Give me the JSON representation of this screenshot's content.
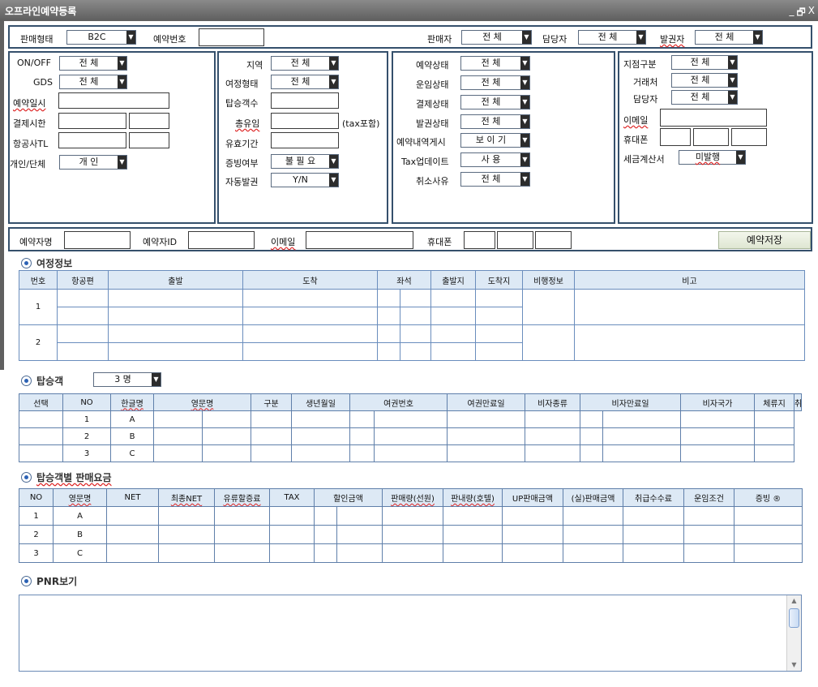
{
  "window": {
    "title": "오프라인예약등록",
    "min": "_",
    "restore": "🗗",
    "close": "X"
  },
  "top": {
    "sale_type_label": "판매형태",
    "sale_type": "B2C",
    "resv_no_label": "예약번호",
    "resv_no": "",
    "seller_label": "판매자",
    "seller": "전 체",
    "manager_label": "담당자",
    "manager": "전 체",
    "issuer_label": "발권자",
    "issuer": "전 체"
  },
  "filter1": {
    "onoff_label": "ON/OFF",
    "onoff": "전 체",
    "gds_label": "GDS",
    "gds": "전 체",
    "resv_date_label": "예약일시",
    "pay_deadline_label": "결제시한",
    "airline_tl_label": "항공사TL",
    "pax_type_label": "개인/단체",
    "pax_type": "개 인"
  },
  "filter2": {
    "region_label": "지역",
    "region": "전 체",
    "trip_type_label": "여정형태",
    "trip_type": "전 체",
    "pax_count_label": "탑승객수",
    "fuel_label": "총유임",
    "tax_note": "(tax포함)",
    "valid_label": "유효기간",
    "proof_label": "증빙여부",
    "proof": "불 필 요",
    "auto_issue_label": "자동발권",
    "auto_issue": "Y/N"
  },
  "filter3": {
    "resv_status_label": "예약상태",
    "resv_status": "전 체",
    "fare_status_label": "운임상태",
    "fare_status": "전 체",
    "pay_status_label": "결제상태",
    "pay_status": "전 체",
    "issue_status_label": "발권상태",
    "issue_status": "전 체",
    "resv_post_label": "예약내역게시",
    "resv_post": "보 이 기",
    "tax_update_label": "Tax업데이트",
    "tax_update": "사  용",
    "cancel_reason_label": "취소사유",
    "cancel_reason": "전 체"
  },
  "filter4": {
    "branch_label": "지점구분",
    "branch": "전 체",
    "client_label": "거래처",
    "client": "전 체",
    "manager_label": "담당자",
    "manager": "전 체",
    "email_label": "이메일",
    "phone_label": "휴대폰",
    "invoice_label": "세금계산서",
    "invoice": "미발행"
  },
  "booker": {
    "name_label": "예약자명",
    "id_label": "예약자ID",
    "email_label": "이메일",
    "phone_label": "휴대폰",
    "save_label": "예약저장"
  },
  "itinerary": {
    "section_title": "여정정보",
    "headers": [
      "번호",
      "항공편",
      "출발",
      "도착",
      "좌석",
      "출발지",
      "도착지",
      "비행정보",
      "비고"
    ],
    "rows": [
      "1",
      "2"
    ]
  },
  "passengers": {
    "section_title": "탑승객",
    "count": "3 명",
    "headers": [
      "선택",
      "NO",
      "한글명",
      "영문명",
      "구분",
      "생년월일",
      "여권번호",
      "여권만료일",
      "비자종류",
      "비자만료일",
      "비자국가",
      "체류지",
      "취소"
    ],
    "rows": [
      {
        "no": "1",
        "name": "A"
      },
      {
        "no": "2",
        "name": "B"
      },
      {
        "no": "3",
        "name": "C"
      }
    ]
  },
  "fares": {
    "section_title": "탑승객별 판매요금",
    "headers": [
      "NO",
      "영문명",
      "NET",
      "최종NET",
      "유류할증료",
      "TAX",
      "할인금액",
      "판매량(선원)",
      "판내량(호텔)",
      "UP판매금액",
      "(실)판매금액",
      "취급수수료",
      "운임조건",
      "증빙 ®"
    ],
    "rows": [
      {
        "no": "1",
        "name": "A"
      },
      {
        "no": "2",
        "name": "B"
      },
      {
        "no": "3",
        "name": "C"
      }
    ]
  },
  "pnr": {
    "section_title": "PNR보기",
    "scroll_up": "▲",
    "scroll_down": "▼"
  },
  "icons": {
    "dropdown": "▼"
  }
}
